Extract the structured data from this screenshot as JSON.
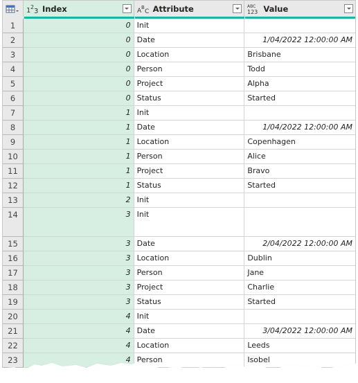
{
  "table": {
    "columns": [
      {
        "type_icon": "whole-number-type",
        "type_glyph": "1²₃",
        "label": "Index"
      },
      {
        "type_icon": "text-type",
        "type_glyph": "AᴮC",
        "label": "Attribute"
      },
      {
        "type_icon": "any-type",
        "type_glyph": "ABC 123",
        "label": "Value"
      }
    ],
    "rows": [
      {
        "n": "1",
        "index": "0",
        "attribute": "Init",
        "value": ""
      },
      {
        "n": "2",
        "index": "0",
        "attribute": "Date",
        "value": "1/04/2022 12:00:00 AM"
      },
      {
        "n": "3",
        "index": "0",
        "attribute": "Location",
        "value": "Brisbane"
      },
      {
        "n": "4",
        "index": "0",
        "attribute": "Person",
        "value": "Todd"
      },
      {
        "n": "5",
        "index": "0",
        "attribute": "Project",
        "value": "Alpha"
      },
      {
        "n": "6",
        "index": "0",
        "attribute": "Status",
        "value": "Started"
      },
      {
        "n": "7",
        "index": "1",
        "attribute": "Init",
        "value": ""
      },
      {
        "n": "8",
        "index": "1",
        "attribute": "Date",
        "value": "1/04/2022 12:00:00 AM"
      },
      {
        "n": "9",
        "index": "1",
        "attribute": "Location",
        "value": "Copenhagen"
      },
      {
        "n": "10",
        "index": "1",
        "attribute": "Person",
        "value": "Alice"
      },
      {
        "n": "11",
        "index": "1",
        "attribute": "Project",
        "value": "Bravo"
      },
      {
        "n": "12",
        "index": "1",
        "attribute": "Status",
        "value": "Started"
      },
      {
        "n": "13",
        "index": "2",
        "attribute": "Init",
        "value": ""
      },
      {
        "n": "14",
        "index": "3",
        "attribute": "Init",
        "value": ""
      },
      {
        "n": "15",
        "index": "3",
        "attribute": "Date",
        "value": "2/04/2022 12:00:00 AM"
      },
      {
        "n": "16",
        "index": "3",
        "attribute": "Location",
        "value": "Dublin"
      },
      {
        "n": "17",
        "index": "3",
        "attribute": "Person",
        "value": "Jane"
      },
      {
        "n": "18",
        "index": "3",
        "attribute": "Project",
        "value": "Charlie"
      },
      {
        "n": "19",
        "index": "3",
        "attribute": "Status",
        "value": "Started"
      },
      {
        "n": "20",
        "index": "4",
        "attribute": "Init",
        "value": ""
      },
      {
        "n": "21",
        "index": "4",
        "attribute": "Date",
        "value": "3/04/2022 12:00:00 AM"
      },
      {
        "n": "22",
        "index": "4",
        "attribute": "Location",
        "value": "Leeds"
      },
      {
        "n": "23",
        "index": "4",
        "attribute": "Person",
        "value": "Isobel"
      }
    ]
  },
  "colors": {
    "selected_column_bg": "#d6efe2",
    "quality_bar": "#17b6a2",
    "header_bg": "#e9e9e9"
  }
}
